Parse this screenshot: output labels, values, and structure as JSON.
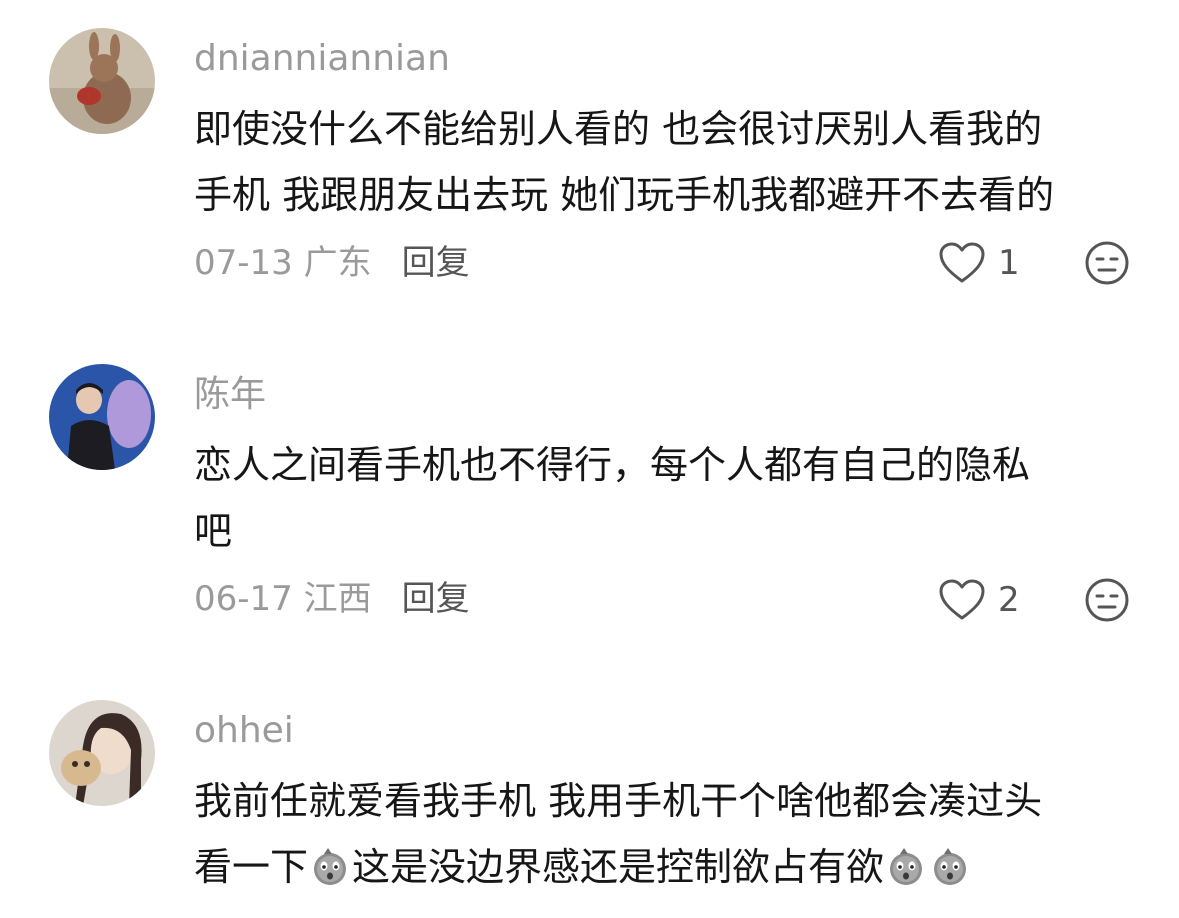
{
  "comments": [
    {
      "username": "dnianniannian",
      "lines": [
        "即使没什么不能给别人看的 也会很讨厌别人看我的",
        "手机 我跟朋友出去玩 她们玩手机我都避开不去看的"
      ],
      "date_location": "07-13 广东",
      "reply_label": "回复",
      "likes": "1"
    },
    {
      "username": "陈年",
      "lines": [
        "恋人之间看手机也不得行，每个人都有自己的隐私",
        "吧"
      ],
      "date_location": "06-17 江西",
      "reply_label": "回复",
      "likes": "2"
    },
    {
      "username": "ohhei",
      "lines": [
        "我前任就爱看我手机 我用手机干个啥他都会凑过头"
      ],
      "line2_parts": [
        "看一下",
        "这是没边界感还是控制欲占有欲"
      ]
    }
  ],
  "icons": {
    "like": "heart-outline-icon",
    "dislike": "neutral-face-icon",
    "inline_emoji": "shocked-potato-emoji"
  }
}
